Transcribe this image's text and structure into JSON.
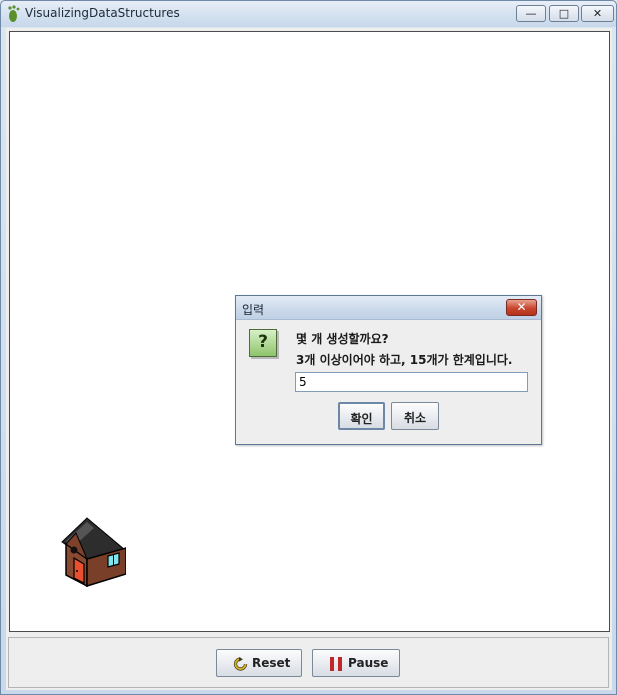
{
  "window": {
    "title": "VisualizingDataStructures",
    "minimize_label": "—",
    "maximize_label": "□",
    "close_label": "✕"
  },
  "controls": {
    "reset_label": "Reset",
    "pause_label": "Pause"
  },
  "canvas": {
    "house_icon": "house-icon"
  },
  "dialog": {
    "title": "입력",
    "close_label": "✕",
    "icon": "question-icon",
    "icon_glyph": "?",
    "message_line1": "몇 개 생성할까요?",
    "message_line2": "3개 이상이어야 하고, 15개가 한계입니다.",
    "input_value": "5",
    "ok_label": "확인",
    "cancel_label": "취소"
  },
  "colors": {
    "titlebar": "#d4e1f0",
    "dialog_close": "#c8452e",
    "pause_icon": "#c0282a",
    "reset_icon": "#c8a018",
    "question_icon": "#8dc46a"
  }
}
